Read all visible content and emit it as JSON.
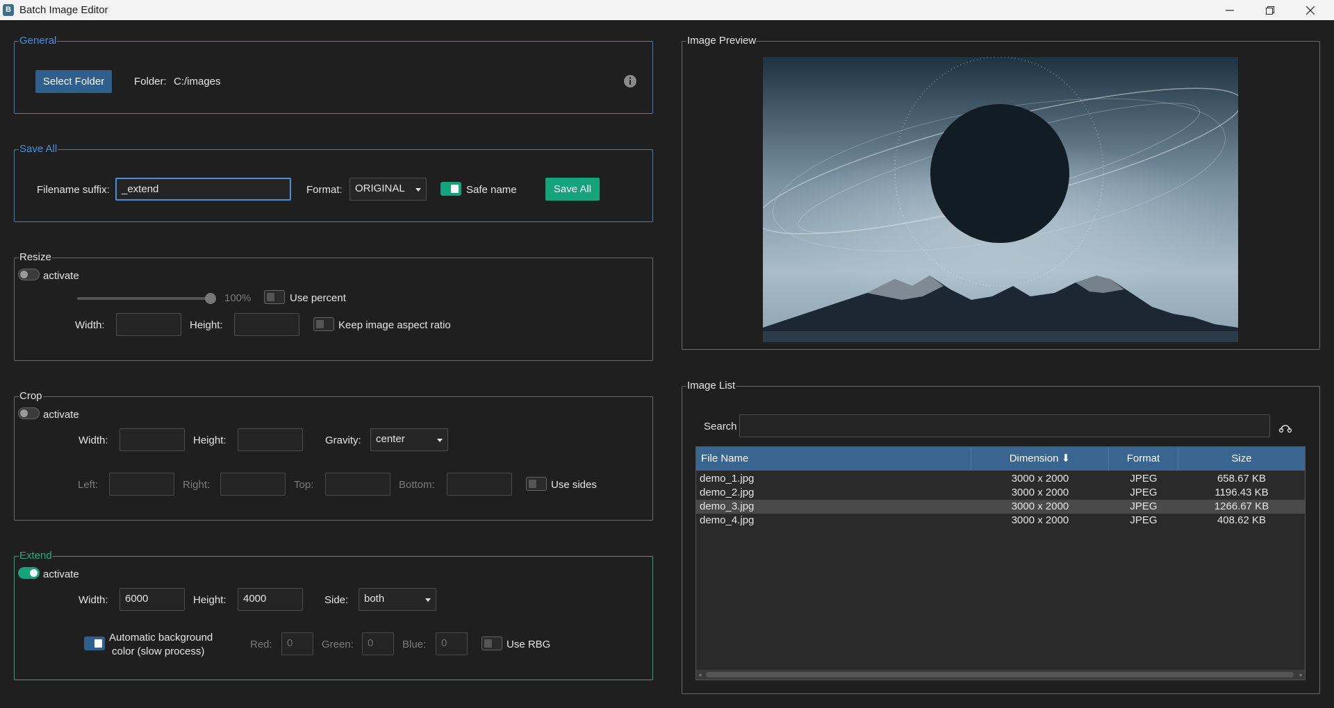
{
  "app": {
    "title": "Batch Image Editor",
    "icon": "app-logo-icon"
  },
  "general": {
    "legend": "General",
    "select_folder": "Select Folder",
    "folder_label": "Folder:",
    "folder_value": "C:/images"
  },
  "save_all": {
    "legend": "Save All",
    "suffix_label": "Filename suffix:",
    "suffix_value": "_extend",
    "format_label": "Format:",
    "format_value": "ORIGINAL",
    "safe_name_label": "Safe name",
    "safe_name_on": true,
    "save_button": "Save All"
  },
  "resize": {
    "legend": "Resize",
    "activate_label": "activate",
    "active": false,
    "percent_value": "100%",
    "use_percent_label": "Use percent",
    "width_label": "Width:",
    "height_label": "Height:",
    "keep_ratio_label": "Keep image aspect ratio"
  },
  "crop": {
    "legend": "Crop",
    "activate_label": "activate",
    "active": false,
    "width_label": "Width:",
    "height_label": "Height:",
    "gravity_label": "Gravity:",
    "gravity_value": "center",
    "left_label": "Left:",
    "right_label": "Right:",
    "top_label": "Top:",
    "bottom_label": "Bottom:",
    "use_sides_label": "Use sides"
  },
  "extend": {
    "legend": "Extend",
    "activate_label": "activate",
    "active": true,
    "width_label": "Width:",
    "width_value": "6000",
    "height_label": "Height:",
    "height_value": "4000",
    "side_label": "Side:",
    "side_value": "both",
    "auto_bg_line1": "Automatic background",
    "auto_bg_line2": "color (slow process)",
    "auto_bg_on": true,
    "red_label": "Red:",
    "red_value": "0",
    "green_label": "Green:",
    "green_value": "0",
    "blue_label": "Blue:",
    "blue_value": "0",
    "use_rgb_label": "Use RBG"
  },
  "preview": {
    "legend": "Image Preview"
  },
  "image_list": {
    "legend": "Image List",
    "search_label": "Search",
    "columns": [
      "File Name",
      "Dimension",
      "Format",
      "Size"
    ],
    "sort_column": "Dimension",
    "rows": [
      [
        "demo_1.jpg",
        "3000 x 2000",
        "JPEG",
        "658.67 KB"
      ],
      [
        "demo_2.jpg",
        "3000 x 2000",
        "JPEG",
        "1196.43 KB"
      ],
      [
        "demo_3.jpg",
        "3000 x 2000",
        "JPEG",
        "1266.67 KB"
      ],
      [
        "demo_4.jpg",
        "3000 x 2000",
        "JPEG",
        "408.62 KB"
      ]
    ],
    "selected_row": 2
  },
  "colors": {
    "accent_blue": "#3e7fc2",
    "accent_green": "#14a37a",
    "header_blue": "#3a6590"
  }
}
